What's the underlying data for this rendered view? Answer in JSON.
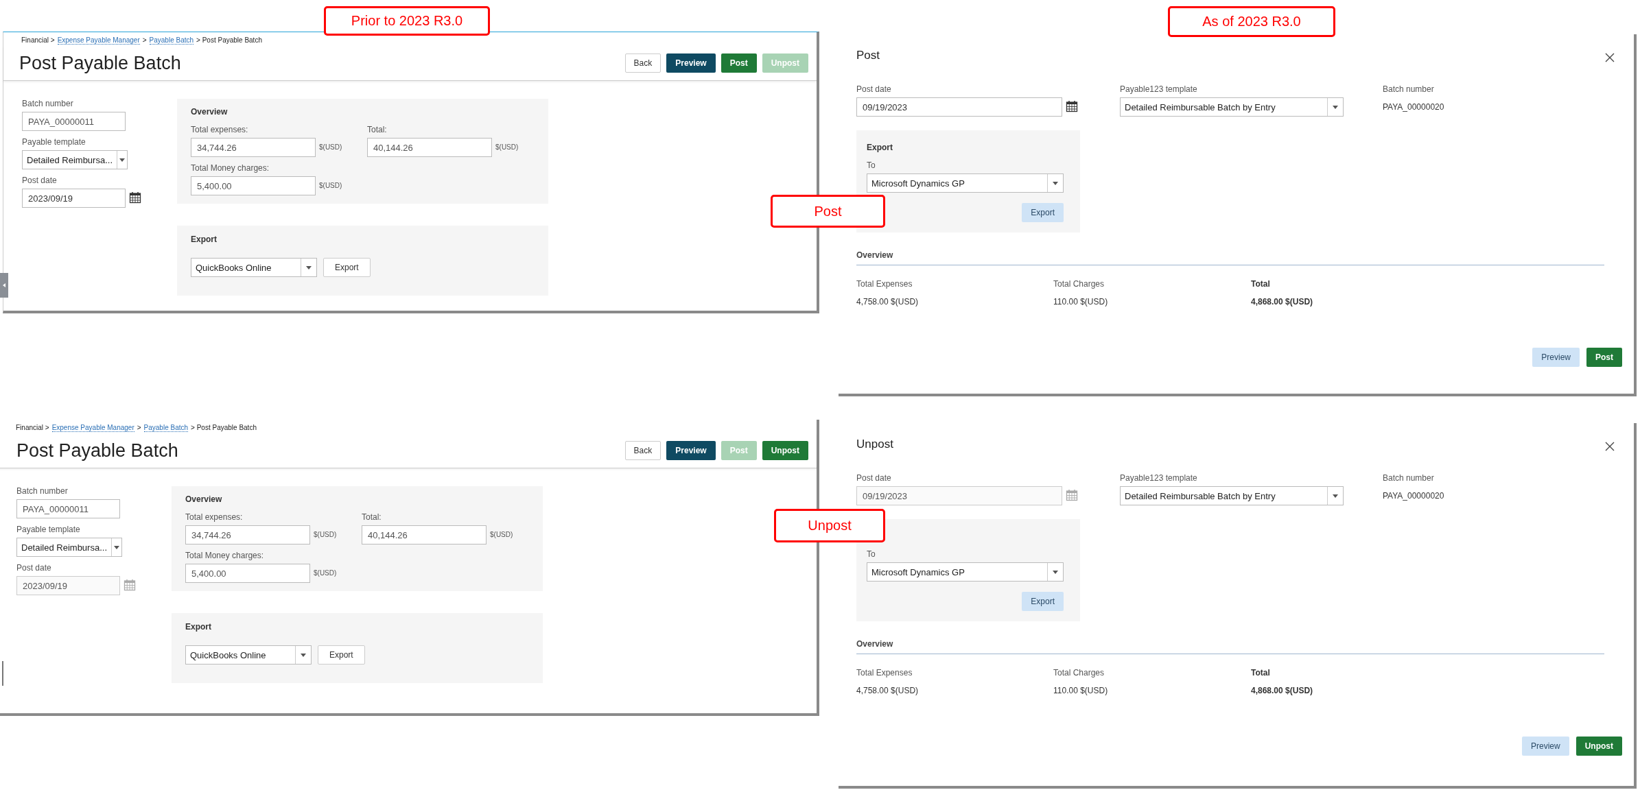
{
  "callouts": [
    {
      "text": "Prior to 2023 R3.0"
    },
    {
      "text": "As of 2023 R3.0"
    },
    {
      "text": "Post"
    },
    {
      "text": "Unpost"
    }
  ],
  "old_pages": [
    {
      "breadcrumb": [
        {
          "label": "Financial >",
          "link": false
        },
        {
          "label": "Expense Payable Manager",
          "link": true
        },
        {
          "label": ">",
          "link": false
        },
        {
          "label": "Payable Batch",
          "link": true
        },
        {
          "label": "> Post Payable Batch",
          "link": false
        }
      ],
      "title": "Post Payable Batch",
      "buttons": [
        {
          "label": "Back",
          "kind": "plain",
          "disabled": false
        },
        {
          "label": "Preview",
          "kind": "dark",
          "disabled": false
        },
        {
          "label": "Post",
          "kind": "primary",
          "disabled": false
        },
        {
          "label": "Unpost",
          "kind": "primary",
          "disabled": true
        }
      ],
      "batch_number": {
        "label": "Batch number",
        "value": "PAYA_00000011"
      },
      "payable_template": {
        "label": "Payable template",
        "value": "Detailed Reimbursa..."
      },
      "post_date": {
        "label": "Post date",
        "value": "2023/09/19",
        "disabled": false
      },
      "overview": {
        "title": "Overview",
        "items": [
          {
            "label": "Total expenses:",
            "value": "34,744.26",
            "unit": "$(USD)"
          },
          {
            "label": "Total:",
            "value": "40,144.26",
            "unit": "$(USD)"
          },
          {
            "label": "Total Money charges:",
            "value": "5,400.00",
            "unit": "$(USD)"
          }
        ]
      },
      "export": {
        "title": "Export",
        "target": "QuickBooks Online",
        "button": "Export"
      }
    },
    {
      "breadcrumb": [
        {
          "label": "Financial >",
          "link": false
        },
        {
          "label": "Expense Payable Manager",
          "link": true
        },
        {
          "label": ">",
          "link": false
        },
        {
          "label": "Payable Batch",
          "link": true
        },
        {
          "label": "> Post Payable Batch",
          "link": false
        }
      ],
      "title": "Post Payable Batch",
      "buttons": [
        {
          "label": "Back",
          "kind": "plain",
          "disabled": false
        },
        {
          "label": "Preview",
          "kind": "dark",
          "disabled": false
        },
        {
          "label": "Post",
          "kind": "primary",
          "disabled": true
        },
        {
          "label": "Unpost",
          "kind": "primary",
          "disabled": false
        }
      ],
      "batch_number": {
        "label": "Batch number",
        "value": "PAYA_00000011"
      },
      "payable_template": {
        "label": "Payable template",
        "value": "Detailed Reimbursa..."
      },
      "post_date": {
        "label": "Post date",
        "value": "2023/09/19",
        "disabled": true
      },
      "overview": {
        "title": "Overview",
        "items": [
          {
            "label": "Total expenses:",
            "value": "34,744.26",
            "unit": "$(USD)"
          },
          {
            "label": "Total:",
            "value": "40,144.26",
            "unit": "$(USD)"
          },
          {
            "label": "Total Money charges:",
            "value": "5,400.00",
            "unit": "$(USD)"
          }
        ]
      },
      "export": {
        "title": "Export",
        "target": "QuickBooks Online",
        "button": "Export"
      }
    }
  ],
  "dialogs": [
    {
      "title": "Post",
      "post_date": {
        "label": "Post date",
        "value": "09/19/2023",
        "disabled": false
      },
      "template": {
        "label": "Payable123 template",
        "value": "Detailed Reimbursable Batch by Entry"
      },
      "batch_number": {
        "label": "Batch number",
        "value": "PAYA_00000020"
      },
      "export": {
        "title": "Export",
        "to_label": "To",
        "target": "Microsoft Dynamics GP",
        "button": "Export"
      },
      "overview": {
        "title": "Overview",
        "items": [
          {
            "label": "Total Expenses",
            "value": "4,758.00 $(USD)",
            "emphasis": false
          },
          {
            "label": "Total Charges",
            "value": "110.00 $(USD)",
            "emphasis": false
          },
          {
            "label": "Total",
            "value": "4,868.00 $(USD)",
            "emphasis": true
          }
        ]
      },
      "buttons": [
        {
          "label": "Preview",
          "kind": "secondary"
        },
        {
          "label": "Post",
          "kind": "primary"
        }
      ]
    },
    {
      "title": "Unpost",
      "post_date": {
        "label": "Post date",
        "value": "09/19/2023",
        "disabled": true
      },
      "template": {
        "label": "Payable123 template",
        "value": "Detailed Reimbursable Batch by Entry"
      },
      "batch_number": {
        "label": "Batch number",
        "value": "PAYA_00000020"
      },
      "export": {
        "to_label": "To",
        "target": "Microsoft Dynamics GP",
        "button": "Export"
      },
      "overview": {
        "title": "Overview",
        "items": [
          {
            "label": "Total Expenses",
            "value": "4,758.00 $(USD)",
            "emphasis": false
          },
          {
            "label": "Total Charges",
            "value": "110.00 $(USD)",
            "emphasis": false
          },
          {
            "label": "Total",
            "value": "4,868.00 $(USD)",
            "emphasis": true
          }
        ]
      },
      "buttons": [
        {
          "label": "Preview",
          "kind": "secondary"
        },
        {
          "label": "Unpost",
          "kind": "primary"
        }
      ]
    }
  ]
}
